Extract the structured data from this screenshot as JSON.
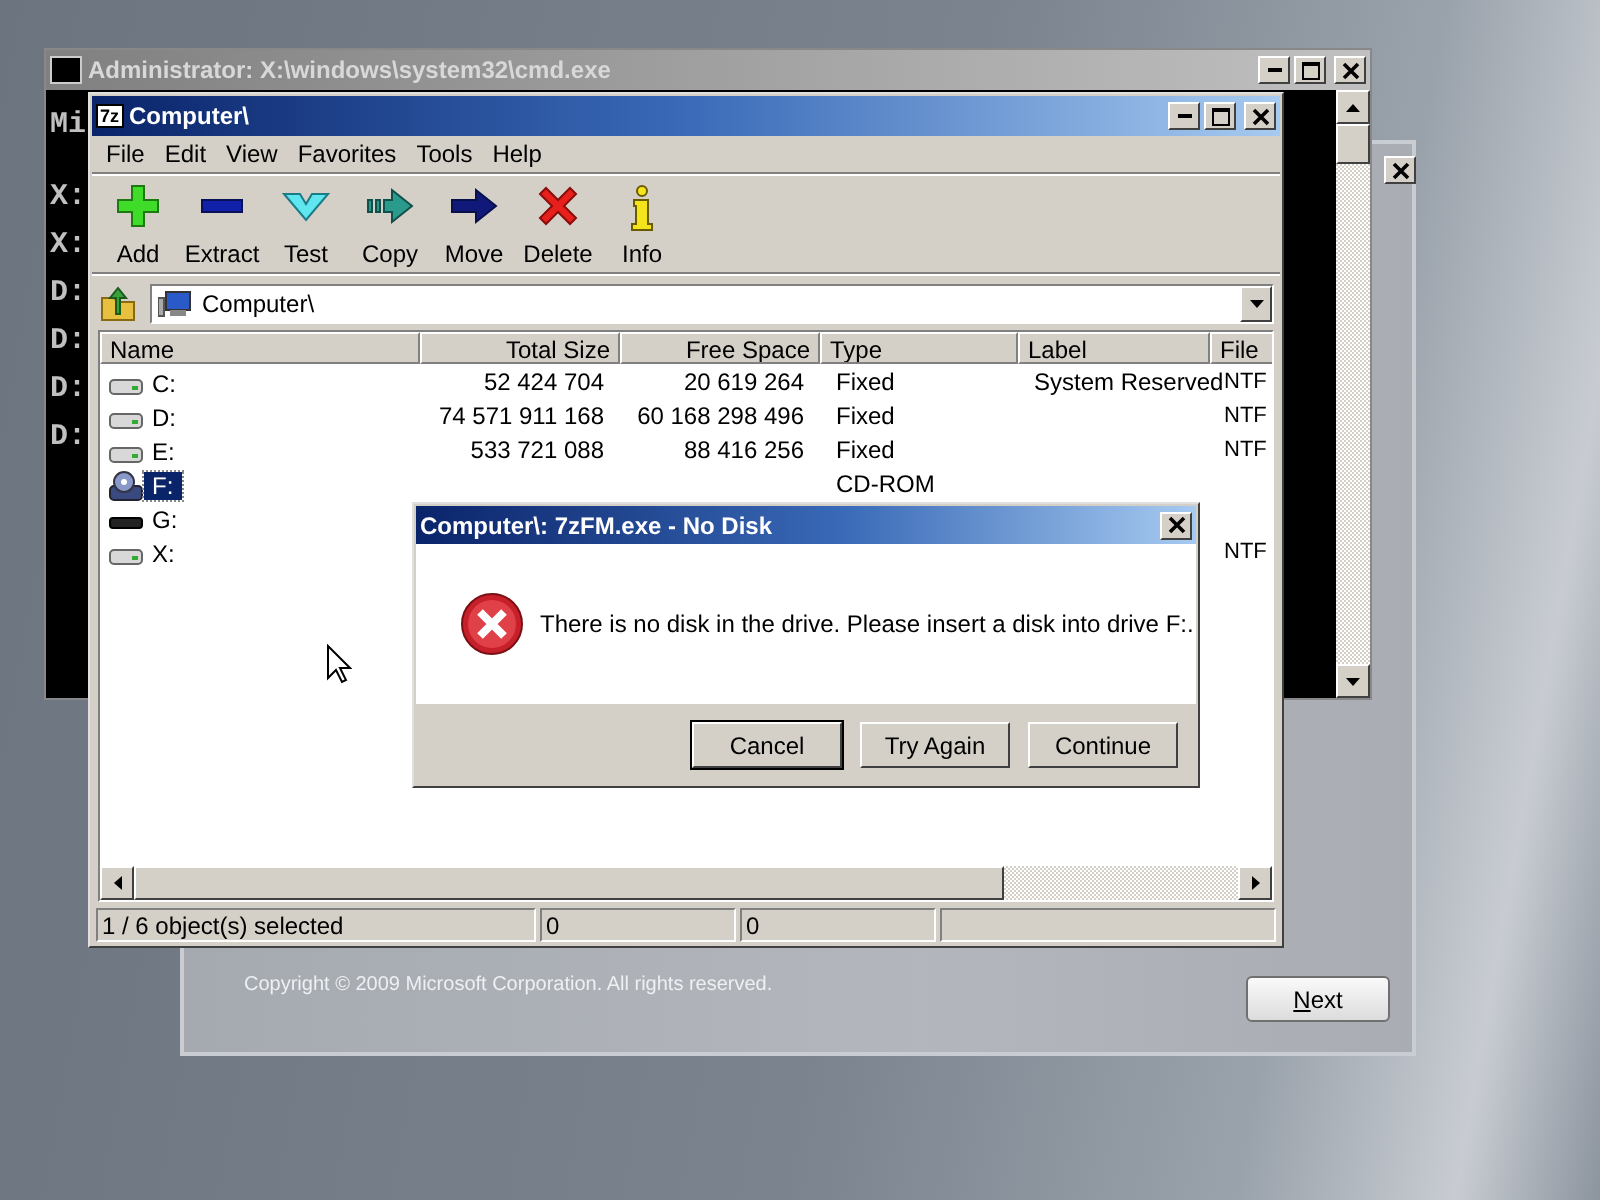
{
  "setup_window": {
    "copyright": "Copyright © 2009 Microsoft Corporation. All rights reserved.",
    "next_button": "Next"
  },
  "console_window": {
    "title": "Administrator: X:\\windows\\system32\\cmd.exe",
    "lines": [
      "Mi",
      "X:",
      "X:",
      "D:",
      "D:",
      "D:",
      "D:"
    ]
  },
  "file_manager": {
    "app_icon": "7z",
    "title": "Computer\\",
    "menu": [
      "File",
      "Edit",
      "View",
      "Favorites",
      "Tools",
      "Help"
    ],
    "toolbar": [
      {
        "label": "Add"
      },
      {
        "label": "Extract"
      },
      {
        "label": "Test"
      },
      {
        "label": "Copy"
      },
      {
        "label": "Move"
      },
      {
        "label": "Delete"
      },
      {
        "label": "Info"
      }
    ],
    "address": "Computer\\",
    "columns": [
      "Name",
      "Total Size",
      "Free Space",
      "Type",
      "Label",
      "File"
    ],
    "rows": [
      {
        "name": "C:",
        "kind": "hdd",
        "selected": false,
        "total_size": "52 424 704",
        "free_space": "20 619 264",
        "type": "Fixed",
        "label": "System Reserved",
        "file_system": "NTF"
      },
      {
        "name": "D:",
        "kind": "hdd",
        "selected": false,
        "total_size": "74 571 911 168",
        "free_space": "60 168 298 496",
        "type": "Fixed",
        "file_system": "NTF"
      },
      {
        "name": "E:",
        "kind": "hdd",
        "selected": false,
        "total_size": "533 721 088",
        "free_space": "88 416 256",
        "type": "Fixed",
        "file_system": "NTF"
      },
      {
        "name": "F:",
        "kind": "cd",
        "selected": true,
        "type": "CD-ROM"
      },
      {
        "name": "G:",
        "kind": "removable",
        "selected": false
      },
      {
        "name": "X:",
        "kind": "hdd",
        "selected": false,
        "file_system": "NTF"
      }
    ],
    "status_bar": [
      "1 / 6 object(s) selected",
      "0",
      "0"
    ]
  },
  "dialog": {
    "title": "Computer\\: 7zFM.exe - No Disk",
    "message": "There is no disk in the drive. Please insert a disk into drive F:.",
    "buttons": [
      {
        "label": "Cancel",
        "selected": true
      },
      {
        "label": "Try Again",
        "selected": false
      },
      {
        "label": "Continue",
        "selected": false
      }
    ]
  }
}
